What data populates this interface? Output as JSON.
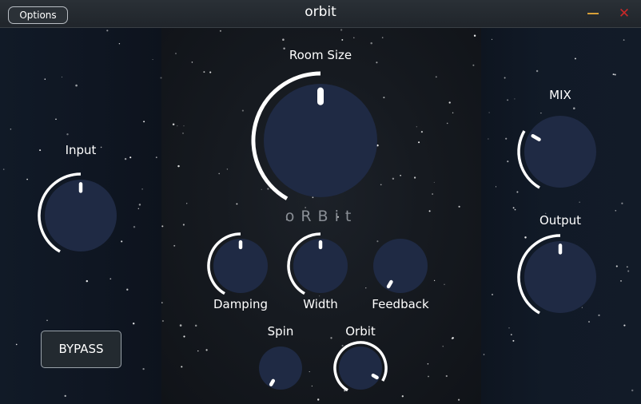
{
  "window": {
    "title": "orbit",
    "options_label": "Options",
    "minimize_icon": "minimize-icon",
    "close_icon": "close-icon",
    "close_glyph": "✕",
    "colors": {
      "minimize": "#d8a038",
      "close": "#c82828"
    }
  },
  "logo": {
    "text": "oRBit"
  },
  "bypass": {
    "label": "BYPASS"
  },
  "knobs": {
    "input": {
      "label": "Input",
      "value": 0.5
    },
    "room_size": {
      "label": "Room Size",
      "value": 0.5
    },
    "damping": {
      "label": "Damping",
      "value": 0.5
    },
    "width": {
      "label": "Width",
      "value": 0.5
    },
    "feedback": {
      "label": "Feedback",
      "value": 0.0
    },
    "spin": {
      "label": "Spin",
      "value": 0.0
    },
    "orbit": {
      "label": "Orbit",
      "value": 0.9
    },
    "mix": {
      "label": "MIX",
      "value": 0.3
    },
    "output": {
      "label": "Output",
      "value": 0.5
    }
  },
  "colors": {
    "knob_body": "#1f2a44",
    "arc": "#ffffff",
    "pointer": "#ffffff"
  }
}
